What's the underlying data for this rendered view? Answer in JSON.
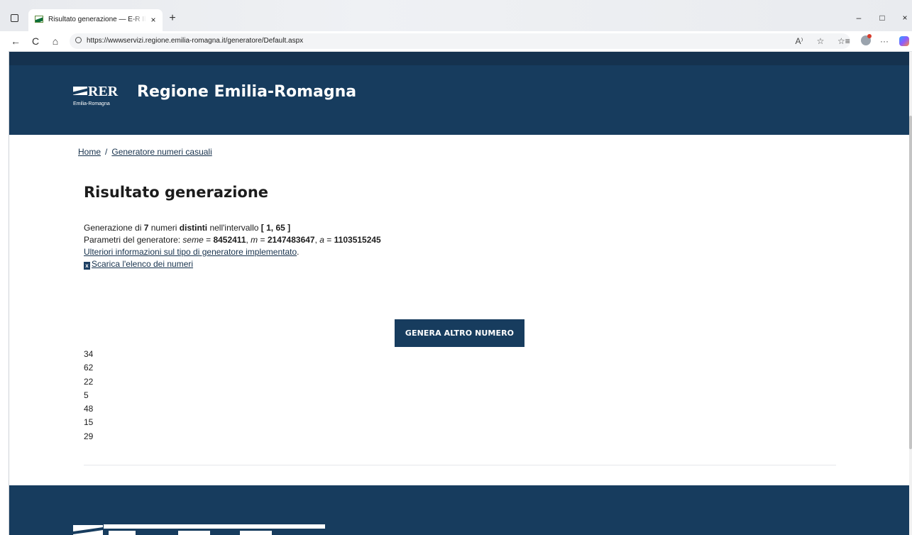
{
  "browser": {
    "tab_title": "Risultato generazione — E-R Il po",
    "tab_close": "×",
    "new_tab": "+",
    "url": "https://wwwservizi.regione.emilia-romagna.it/generatore/Default.aspx",
    "window_controls": {
      "minimize": "–",
      "maximize": "□",
      "close": "×"
    },
    "nav": {
      "back": "←",
      "reload": "C",
      "home": "⌂"
    },
    "toolbar": {
      "read_aloud": "A⁾",
      "favorite": "☆",
      "favorites": "☆≡",
      "more": "···"
    }
  },
  "header": {
    "logo_text": "RER",
    "logo_sub": "Emilia-Romagna",
    "site_title": "Regione Emilia-Romagna"
  },
  "breadcrumb": {
    "home": "Home",
    "separator": "/",
    "current": "Generatore numeri casuali"
  },
  "page_title": "Risultato generazione",
  "info": {
    "line1": {
      "prefix": "Generazione di ",
      "count": "7",
      "mid": " numeri ",
      "distinct": "distinti",
      "mid2": " nell'intervallo ",
      "range": "[ 1, 65 ]"
    },
    "line2": {
      "prefix": "Parametri del generatore: ",
      "seme_label": "seme",
      "eq1": " = ",
      "seme_value": "8452411",
      "sep1": ", ",
      "m_label": "m",
      "eq2": " = ",
      "m_value": "2147483647",
      "sep2": ", ",
      "a_label": "a",
      "eq3": " = ",
      "a_value": "1103515245"
    },
    "more_info_link": "Ulteriori informazioni sul tipo di generatore implementato",
    "more_info_suffix": ".",
    "download_icon": "x",
    "download_link": "Scarica l'elenco dei numeri"
  },
  "button": {
    "generate": "GENERA ALTRO NUMERO"
  },
  "numbers": [
    "34",
    "62",
    "22",
    "5",
    "48",
    "15",
    "29"
  ],
  "colors": {
    "header_bg": "#173c5e",
    "top_strip": "#15324f",
    "button_bg": "#173c5e",
    "link": "#17324d"
  }
}
